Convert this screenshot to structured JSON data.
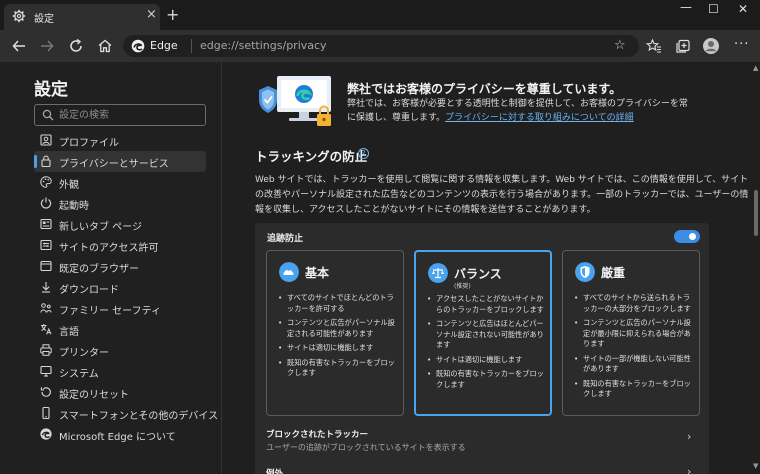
{
  "tab": {
    "title": "設定",
    "close": "×",
    "new_tab": "+"
  },
  "window": {
    "minimize": "—",
    "maximize": "☐",
    "close": "✕"
  },
  "address": {
    "site": "Edge",
    "url": "edge://settings/privacy"
  },
  "sidebar": {
    "title": "設定",
    "search_placeholder": "設定の検索",
    "items": [
      {
        "label": "プロファイル",
        "icon": "profile-icon"
      },
      {
        "label": "プライバシーとサービス",
        "icon": "lock-icon",
        "active": true
      },
      {
        "label": "外観",
        "icon": "palette-icon"
      },
      {
        "label": "起動時",
        "icon": "power-icon"
      },
      {
        "label": "新しいタブ ページ",
        "icon": "newtab-page-icon"
      },
      {
        "label": "サイトのアクセス許可",
        "icon": "site-permissions-icon"
      },
      {
        "label": "既定のブラウザー",
        "icon": "browser-icon"
      },
      {
        "label": "ダウンロード",
        "icon": "download-icon"
      },
      {
        "label": "ファミリー セーフティ",
        "icon": "family-icon"
      },
      {
        "label": "言語",
        "icon": "language-icon"
      },
      {
        "label": "プリンター",
        "icon": "printer-icon"
      },
      {
        "label": "システム",
        "icon": "system-icon"
      },
      {
        "label": "設定のリセット",
        "icon": "reset-icon"
      },
      {
        "label": "スマートフォンとその他のデバイス",
        "icon": "phone-icon"
      },
      {
        "label": "Microsoft Edge について",
        "icon": "edge-icon"
      }
    ]
  },
  "hero": {
    "title": "弊社ではお客様のプライバシーを尊重しています。",
    "desc": "弊社では、お客様が必要とする透明性と制御を提供して、お客様のプライバシーを常に保護し、尊重します。",
    "link": "プライバシーに対する取り組みについての詳細"
  },
  "tracking": {
    "title": "トラッキングの防止",
    "help": "?",
    "desc": "Web サイトでは、トラッカーを使用して閲覧に関する情報を収集します。Web サイトでは、この情報を使用して、サイトの改善やパーソナル設定された広告などのコンテンツの表示を行う場合があります。一部のトラッカーでは、ユーザーの情報を収集し、アクセスしたことがないサイトにその情報を送信することがあります。",
    "toggle_label": "追跡防止",
    "toggle_on": true,
    "cards": [
      {
        "title": "基本",
        "subtitle": "",
        "selected": false,
        "accent": "#4aa3ef",
        "bullets": [
          "すべてのサイトでほとんどのトラッカーを許可する",
          "コンテンツと広告がパーソナル設定される可能性があります",
          "サイトは適切に機能します",
          "既知の有害なトラッカーをブロックします"
        ]
      },
      {
        "title": "バランス",
        "subtitle": "(推奨)",
        "selected": true,
        "accent": "#4aa3ef",
        "bullets": [
          "アクセスしたことがないサイトからのトラッカーをブロックします",
          "コンテンツと広告はほとんどパーソナル設定されない可能性があります",
          "サイトは適切に機能します",
          "既知の有害なトラッカーをブロックします"
        ]
      },
      {
        "title": "厳重",
        "subtitle": "",
        "selected": false,
        "accent": "#4aa3ef",
        "bullets": [
          "すべてのサイトから送られるトラッカーの大部分をブロックします",
          "コンテンツと広告のパーソナル設定が最小限に抑えられる場合があります",
          "サイトの一部が機能しない可能性があります",
          "既知の有害なトラッカーをブロックします"
        ]
      }
    ],
    "blocked": {
      "title": "ブロックされたトラッカー",
      "desc": "ユーザーの追跡がブロックされているサイトを表示する"
    },
    "exceptions": {
      "title": "例外"
    }
  }
}
